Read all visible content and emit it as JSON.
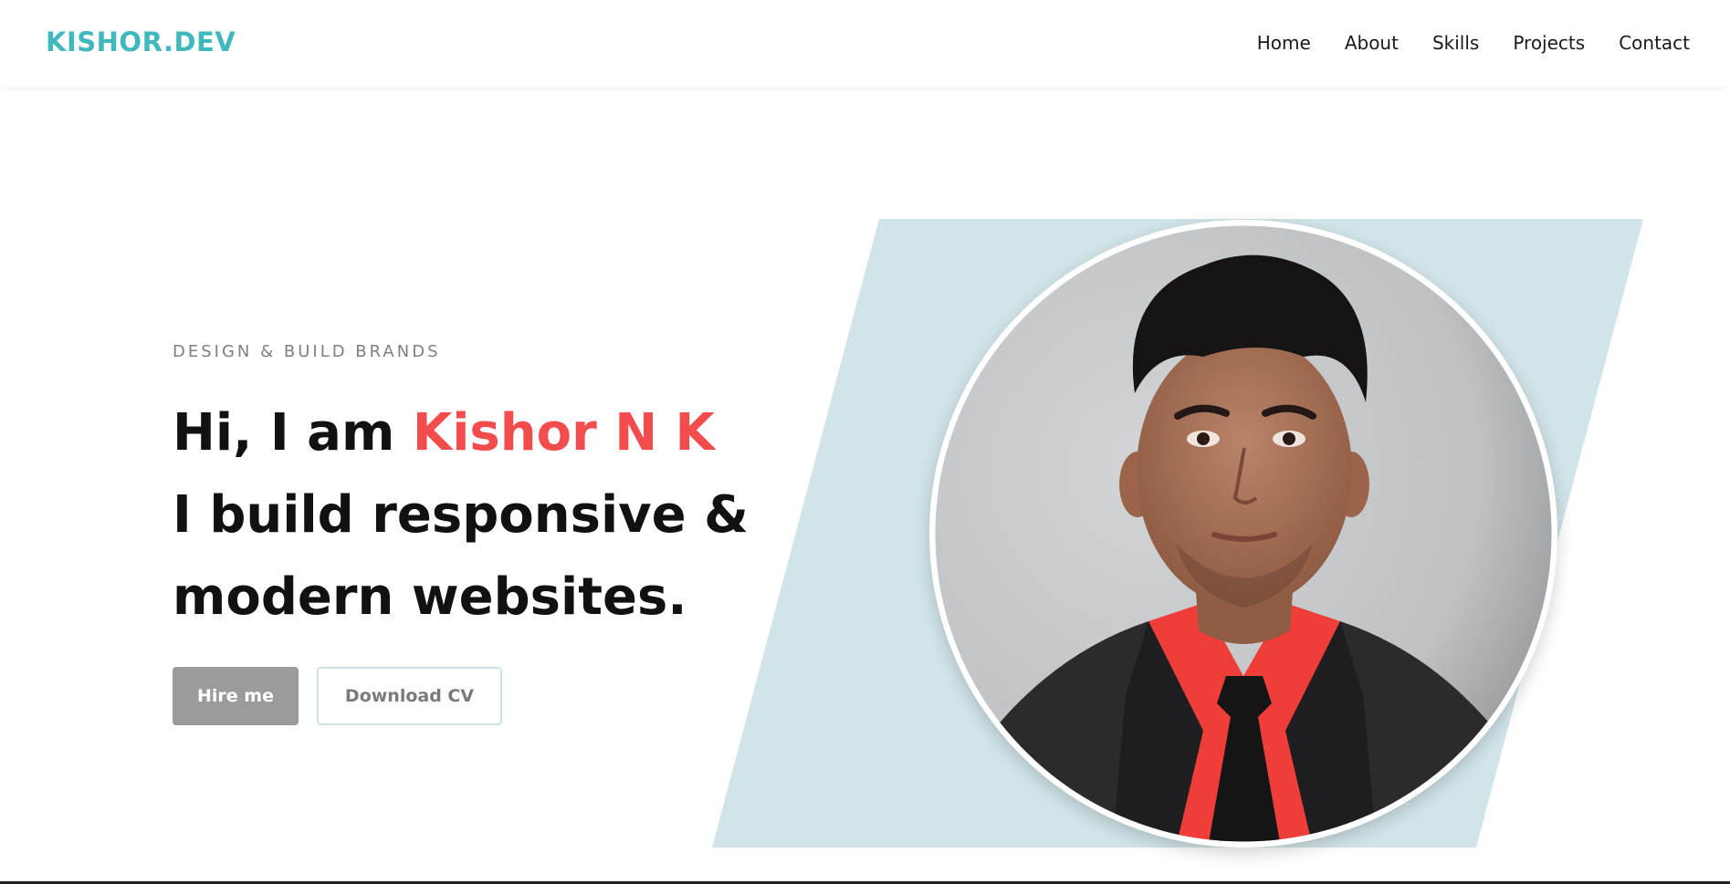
{
  "header": {
    "brand": "KISHOR.DEV",
    "nav": [
      {
        "label": "Home"
      },
      {
        "label": "About"
      },
      {
        "label": "Skills"
      },
      {
        "label": "Projects"
      },
      {
        "label": "Contact"
      }
    ]
  },
  "hero": {
    "subtitle": "DESIGN & BUILD BRANDS",
    "headline": {
      "greeting": "Hi, I am ",
      "name": "Kishor N K",
      "line2": "I build responsive &",
      "line3": "modern websites."
    },
    "buttons": {
      "primary": "Hire me",
      "secondary": "Download CV"
    }
  },
  "colors": {
    "brand": "#3fb8be",
    "accent": "#f24c4c",
    "slant_bg": "#d1e4e8",
    "button_primary": "#9b9b9b"
  },
  "images": {
    "portrait": "profile-photo"
  }
}
